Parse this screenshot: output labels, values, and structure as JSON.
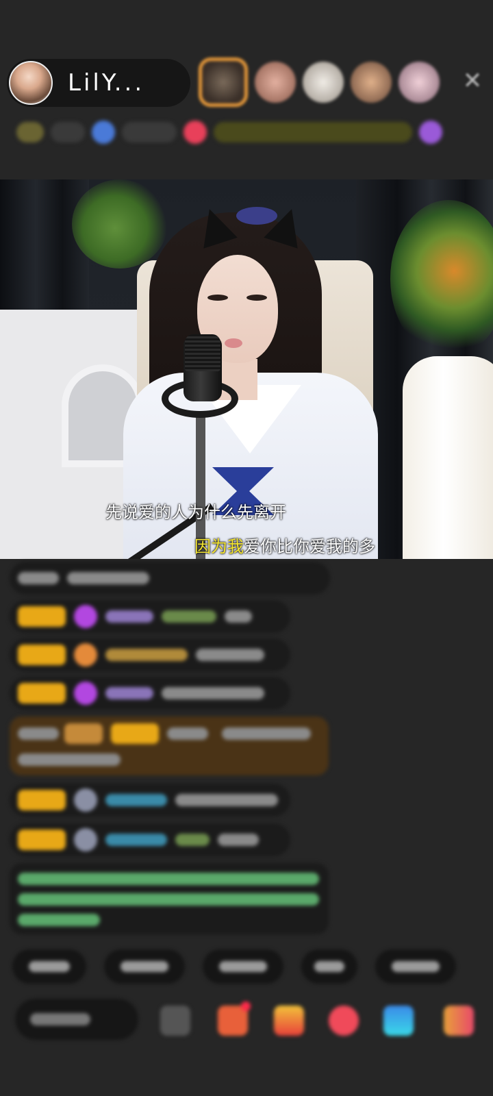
{
  "host": {
    "name": "LilY...",
    "avatar_icon": "host-avatar-photo"
  },
  "top_viewers": [
    {
      "icon": "top-viewer-avatar",
      "color": "#6a5a4a"
    },
    {
      "icon": "viewer-avatar",
      "color": "#c9948a"
    },
    {
      "icon": "viewer-avatar",
      "color": "#d9d2c8"
    },
    {
      "icon": "viewer-avatar",
      "color": "#b88a6a"
    },
    {
      "icon": "viewer-avatar",
      "color": "#d8b0b8"
    }
  ],
  "close_icon": "close-icon",
  "video": {
    "subtitle_line1": "先说爱的人为什么先离开",
    "subtitle_line2_highlight": "因为我",
    "subtitle_line2_rest": "爱你比你爱我的多",
    "highlight_color": "#f6e732"
  },
  "chat_colors": {
    "level_badge": "#e8a817",
    "row_background": "#1b1b1b",
    "gift_banner": "#4a3316",
    "system_notice_text": "#5aa86a"
  }
}
